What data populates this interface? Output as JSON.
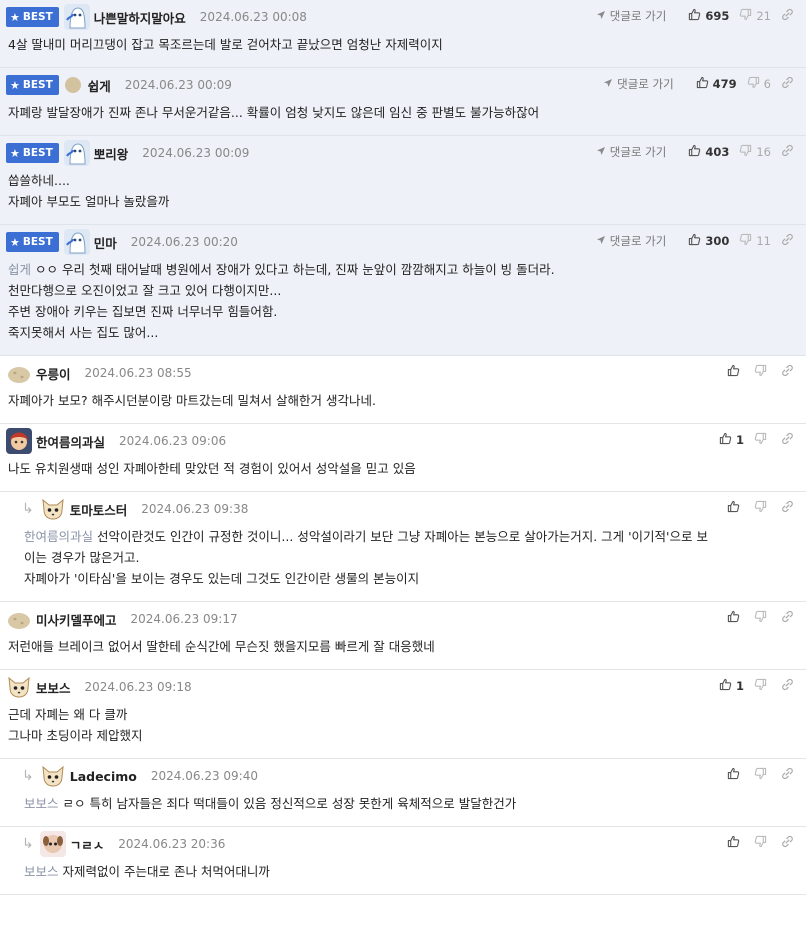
{
  "labels": {
    "best": "BEST",
    "goto": "댓글로 가기"
  },
  "comments": [
    {
      "best": true,
      "avatar": "ghost",
      "nick": "나쁜말하지말아요",
      "date": "2024.06.23 00:08",
      "goto": true,
      "up": "695",
      "down": "21",
      "lines": [
        "4살 딸내미 머리끄댕이 잡고 목조르는데 발로 걷어차고 끝났으면 엄청난 자제력이지"
      ]
    },
    {
      "best": true,
      "avatar": "dot",
      "nick": "쉽게",
      "date": "2024.06.23 00:09",
      "goto": true,
      "up": "479",
      "down": "6",
      "lines": [
        "자폐랑 발달장애가 진짜 존나 무서운거같음... 확률이 엄청 낮지도 않은데 임신 중 판별도 불가능하잖어"
      ]
    },
    {
      "best": true,
      "avatar": "ghost",
      "nick": "뽀리왕",
      "date": "2024.06.23 00:09",
      "goto": true,
      "up": "403",
      "down": "16",
      "lines": [
        "씁쓸하네....",
        "자폐아 부모도 얼마나 놀랐을까"
      ]
    },
    {
      "best": true,
      "avatar": "ghost",
      "nick": "민마",
      "date": "2024.06.23 00:20",
      "goto": true,
      "up": "300",
      "down": "11",
      "mention": "쉽게",
      "lines": [
        "ㅇㅇ 우리 첫째 태어날때 병원에서 장애가 있다고 하는데, 진짜 눈앞이 깜깜해지고 하늘이 빙 돌더라.",
        "천만다행으로 오진이었고 잘 크고 있어 다행이지만...",
        "주변 장애아 키우는 집보면 진짜 너무너무 힘들어함.",
        "죽지못해서 사는 집도 많어..."
      ]
    },
    {
      "best": false,
      "avatar": "potato",
      "nick": "우릉이",
      "date": "2024.06.23 08:55",
      "up": "",
      "lines": [
        "자폐아가 보모? 해주시던분이랑 마트갔는데 밀쳐서 살해한거 생각나네."
      ]
    },
    {
      "best": false,
      "avatar": "face",
      "nick": "한여름의과실",
      "date": "2024.06.23 09:06",
      "up": "1",
      "lines": [
        "나도 유치원생때 성인 자폐아한테 맞았던 적 경험이 있어서 성악설을 믿고 있음"
      ]
    },
    {
      "best": false,
      "reply": true,
      "avatar": "cat",
      "nick": "토마토스터",
      "date": "2024.06.23 09:38",
      "up": "",
      "mention": "한여름의과실",
      "lines": [
        "선악이란것도 인간이 규정한 것이니... 성악설이라기 보단 그냥 자폐아는 본능으로 살아가는거지. 그게 '이기적'으로 보",
        "이는 경우가 많은거고.",
        "자폐아가 '이타심'을 보이는 경우도 있는데 그것도 인간이란 생물의 본능이지"
      ]
    },
    {
      "best": false,
      "avatar": "potato",
      "nick": "미사키델푸에고",
      "date": "2024.06.23 09:17",
      "up": "",
      "lines": [
        "저런애들 브레이크 없어서 딸한테 순식간에 무슨짓 했을지모름 빠르게 잘 대응했네"
      ]
    },
    {
      "best": false,
      "avatar": "cat",
      "nick": "보보스",
      "date": "2024.06.23 09:18",
      "up": "1",
      "lines": [
        "근데 자폐는 왜 다 클까",
        "그나마 초딩이라 제압했지"
      ]
    },
    {
      "best": false,
      "reply": true,
      "avatar": "cat",
      "nick": "Ladecimo",
      "date": "2024.06.23 09:40",
      "up": "",
      "mention": "보보스",
      "lines": [
        "ㄹㅇ 특히 남자들은 죄다 떡대들이 있음 정신적으로 성장 못한게 육체적으로 발달한건가"
      ]
    },
    {
      "best": false,
      "reply": true,
      "avatar": "dog",
      "nick": "ㄱㄹㅅ",
      "date": "2024.06.23 20:36",
      "up": "",
      "mention": "보보스",
      "lines": [
        "자제력없이 주는대로 존나 처먹어대니까"
      ]
    }
  ]
}
